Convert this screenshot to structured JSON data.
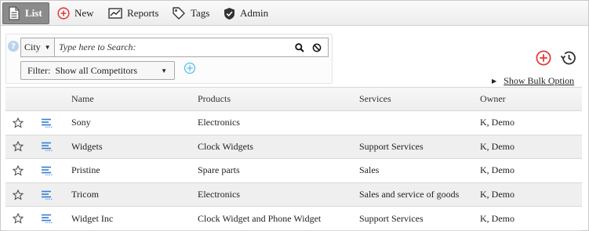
{
  "toolbar": {
    "items": [
      {
        "label": "List",
        "icon": "document-icon",
        "active": true
      },
      {
        "label": "New",
        "icon": "plus-circle-icon",
        "active": false
      },
      {
        "label": "Reports",
        "icon": "line-chart-icon",
        "active": false
      },
      {
        "label": "Tags",
        "icon": "tag-icon",
        "active": false
      },
      {
        "label": "Admin",
        "icon": "shield-check-icon",
        "active": false
      }
    ]
  },
  "search": {
    "field_select": "City",
    "placeholder": "Type here to Search:",
    "value": ""
  },
  "filter": {
    "label": "Filter:",
    "selected": "Show all Competitors"
  },
  "bulk": {
    "label": "Show Bulk Option"
  },
  "colors": {
    "toolbar_active": "#8b8b8b",
    "add_red": "#e23c3c",
    "add_blue": "#2bb6ea",
    "detail_icon": "#2f7fd6",
    "alt_row": "#efefef"
  },
  "table": {
    "columns": [
      "Name",
      "Products",
      "Services",
      "Owner"
    ],
    "rows": [
      {
        "name": "Sony",
        "products": "Electronics",
        "services": "",
        "owner": "K, Demo"
      },
      {
        "name": "Widgets",
        "products": "Clock Widgets",
        "services": "Support Services",
        "owner": "K, Demo"
      },
      {
        "name": "Pristine",
        "products": "Spare parts",
        "services": "Sales",
        "owner": "K, Demo"
      },
      {
        "name": "Tricom",
        "products": "Electronics",
        "services": "Sales and service of goods",
        "owner": "K, Demo"
      },
      {
        "name": "Widget Inc",
        "products": "Clock Widget and Phone Widget",
        "services": "Support Services",
        "owner": "K, Demo"
      }
    ]
  }
}
